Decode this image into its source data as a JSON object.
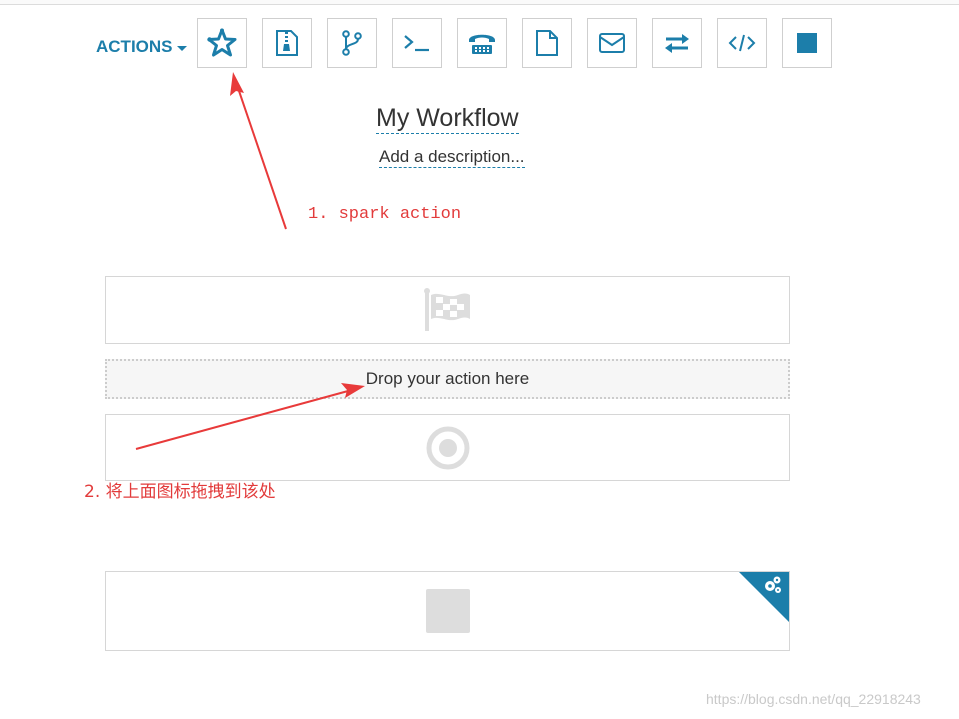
{
  "toolbar": {
    "actions_label": "ACTIONS",
    "tools": [
      {
        "name": "spark-action",
        "icon": "spark-star-icon"
      },
      {
        "name": "archive-action",
        "icon": "file-archive-icon"
      },
      {
        "name": "fork-action",
        "icon": "git-fork-icon"
      },
      {
        "name": "shell-action",
        "icon": "terminal-prompt-icon"
      },
      {
        "name": "ssh-action",
        "icon": "telephone-icon"
      },
      {
        "name": "document-action",
        "icon": "file-icon"
      },
      {
        "name": "email-action",
        "icon": "envelope-icon"
      },
      {
        "name": "distcp-action",
        "icon": "exchange-arrows-icon"
      },
      {
        "name": "code-action",
        "icon": "code-icon"
      },
      {
        "name": "generic-action",
        "icon": "stop-square-icon"
      }
    ],
    "accent_color": "#1c7eaa"
  },
  "workflow": {
    "title": "My Workflow",
    "description": "Add a description...",
    "dropzone_text": "Drop your action here",
    "start_icon": "flag-icon",
    "end_icon": "target-circle-icon",
    "kill_icon": "square-icon",
    "settings_icon": "cogs-icon"
  },
  "annotations": {
    "step1": "1. spark action",
    "step2": "2. 将上面图标拖拽到该处",
    "color": "#e23b3b"
  },
  "watermark": "https://blog.csdn.net/qq_22918243"
}
